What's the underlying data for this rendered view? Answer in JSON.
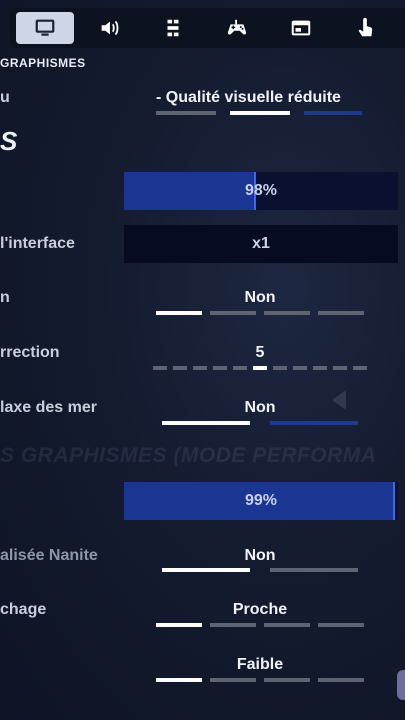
{
  "tabs": [
    {
      "id": "display",
      "icon": "monitor-icon",
      "active": true
    },
    {
      "id": "audio",
      "icon": "speaker-icon",
      "active": false
    },
    {
      "id": "network",
      "icon": "network-icon",
      "active": false
    },
    {
      "id": "controller",
      "icon": "gamepad-icon",
      "active": false
    },
    {
      "id": "window",
      "icon": "window-icon",
      "active": false
    },
    {
      "id": "touch",
      "icon": "touch-icon",
      "active": false
    }
  ],
  "section": {
    "title": "GRAPHISMES",
    "heading": "S",
    "ghost_title": "S GRAPHISMES (MODE PERFORMA"
  },
  "rows": {
    "quality": {
      "label": "u",
      "value": "- Qualité visuelle réduite"
    },
    "brightness": {
      "value": "98%",
      "fill": 0.48
    },
    "ui_contrast": {
      "label": "l'interface",
      "value": "x1"
    },
    "toggle_n": {
      "label": "n",
      "value": "Non"
    },
    "correction": {
      "label": "rrection",
      "value": "5"
    },
    "parallax": {
      "label": "laxe des mer",
      "value": "Non"
    },
    "perf_slider": {
      "value": "99%",
      "fill": 0.99
    },
    "nanite": {
      "label": "alisée Nanite",
      "value": "Non"
    },
    "draw_distance": {
      "label": "chage",
      "value": "Proche"
    },
    "last": {
      "value": "Faible"
    }
  },
  "colors": {
    "accent": "#1a3592",
    "active_segment": "#ffffff",
    "inactive_segment": "#5f6472"
  }
}
